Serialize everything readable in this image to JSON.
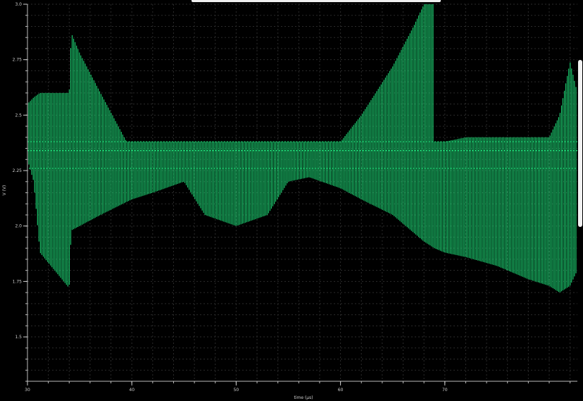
{
  "chart_data": {
    "type": "line",
    "title": "",
    "xlabel": "time (µs)",
    "ylabel": "V (V)",
    "xlim": [
      30,
      82.7
    ],
    "ylim": [
      1.3,
      3.0
    ],
    "x_ticks": [
      30,
      40,
      50,
      60,
      70
    ],
    "x_tick_labels": [
      "30",
      "40",
      "50",
      "60",
      "70"
    ],
    "y_ticks": [
      1.5,
      1.75,
      2.0,
      2.25,
      2.5,
      2.75,
      3.0
    ],
    "y_tick_labels": [
      "1.5",
      "1.75",
      "2.0",
      "2.25",
      "2.5",
      "2.75",
      "3.0"
    ],
    "grid": true,
    "series": [
      {
        "color": "#1fe07a",
        "center_level": 2.34,
        "upper_level": 2.38,
        "lower_level": 2.26,
        "envelope_max": {
          "x": [
            30.0,
            30.6,
            31.2,
            34.0,
            34.2,
            35.0,
            37.0,
            39.5,
            40.0,
            42.0,
            45.0,
            50.0,
            55.0,
            57.0,
            59.0,
            60.0,
            62.0,
            65.0,
            67.0,
            68.0,
            68.9,
            69.0,
            70.0,
            72.0,
            80.0,
            81.0,
            82.0,
            82.7
          ],
          "y": [
            2.55,
            2.58,
            2.6,
            2.6,
            2.87,
            2.78,
            2.6,
            2.38,
            2.38,
            2.38,
            2.38,
            2.38,
            2.38,
            2.38,
            2.38,
            2.38,
            2.5,
            2.72,
            2.9,
            3.0,
            3.0,
            2.38,
            2.38,
            2.4,
            2.4,
            2.5,
            2.74,
            2.6
          ]
        },
        "envelope_min": {
          "x": [
            30.0,
            30.6,
            31.2,
            34.0,
            34.2,
            35.0,
            37.0,
            40.0,
            42.0,
            45.0,
            47.0,
            50.0,
            53.0,
            55.0,
            57.0,
            60.0,
            62.0,
            65.0,
            67.0,
            68.0,
            69.0,
            70.0,
            72.0,
            75.0,
            78.0,
            80.0,
            81.0,
            82.0,
            82.7
          ],
          "y": [
            2.3,
            2.2,
            1.88,
            1.72,
            1.98,
            2.0,
            2.05,
            2.12,
            2.15,
            2.2,
            2.05,
            2.0,
            2.05,
            2.2,
            2.22,
            2.17,
            2.12,
            2.05,
            1.97,
            1.93,
            1.9,
            1.88,
            1.86,
            1.82,
            1.76,
            1.73,
            1.7,
            1.73,
            1.8
          ]
        }
      }
    ]
  },
  "ui": {
    "scrollbar": "vertical-scrollbar-handle"
  }
}
